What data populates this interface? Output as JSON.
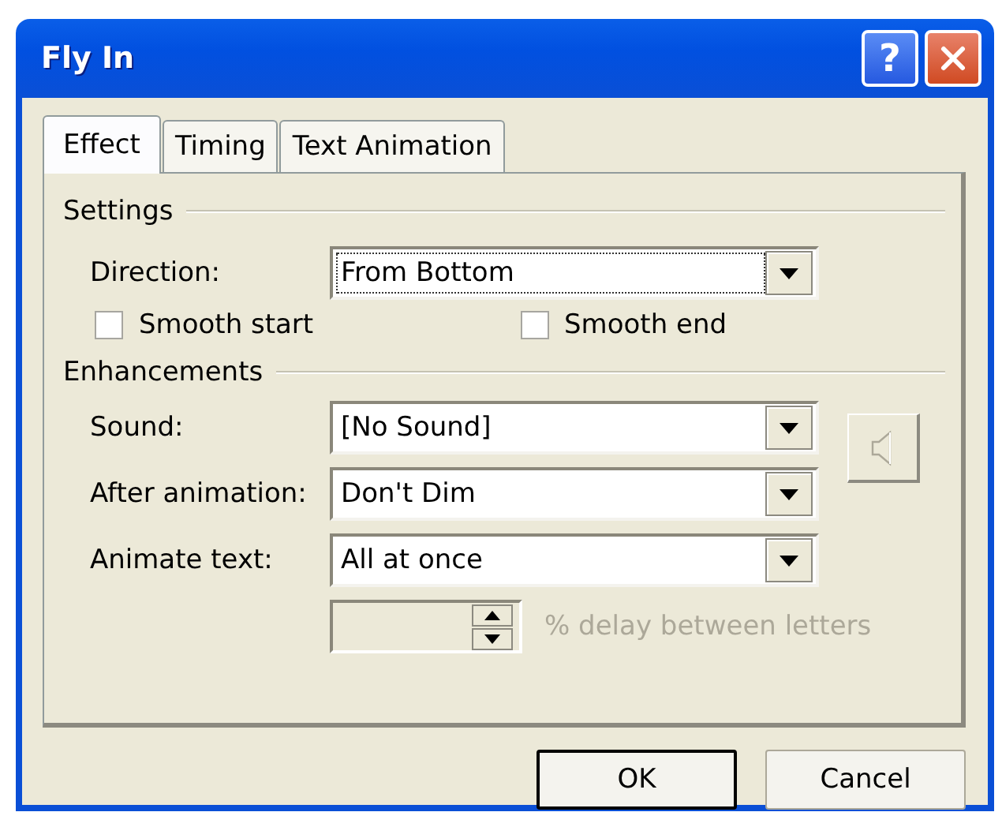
{
  "window": {
    "title": "Fly In",
    "help_label": "?"
  },
  "tabs": [
    {
      "label": "Effect",
      "selected": true
    },
    {
      "label": "Timing",
      "selected": false
    },
    {
      "label": "Text Animation",
      "selected": false
    }
  ],
  "settings": {
    "heading": "Settings",
    "direction": {
      "label": "Direction:",
      "value": "From Bottom",
      "focused": true
    },
    "checkboxes": [
      {
        "label": "Smooth start",
        "checked": false
      },
      {
        "label": "Smooth end",
        "checked": false
      }
    ]
  },
  "enhancements": {
    "heading": "Enhancements",
    "fields": [
      {
        "label": "Sound:",
        "value": "[No Sound]"
      },
      {
        "label": "After animation:",
        "value": "Don't Dim"
      },
      {
        "label": "Animate text:",
        "value": "All at once"
      }
    ],
    "delay": {
      "label": "% delay between letters",
      "disabled": true
    }
  },
  "buttons": [
    {
      "label": "OK",
      "default": true
    },
    {
      "label": "Cancel",
      "default": false
    }
  ]
}
